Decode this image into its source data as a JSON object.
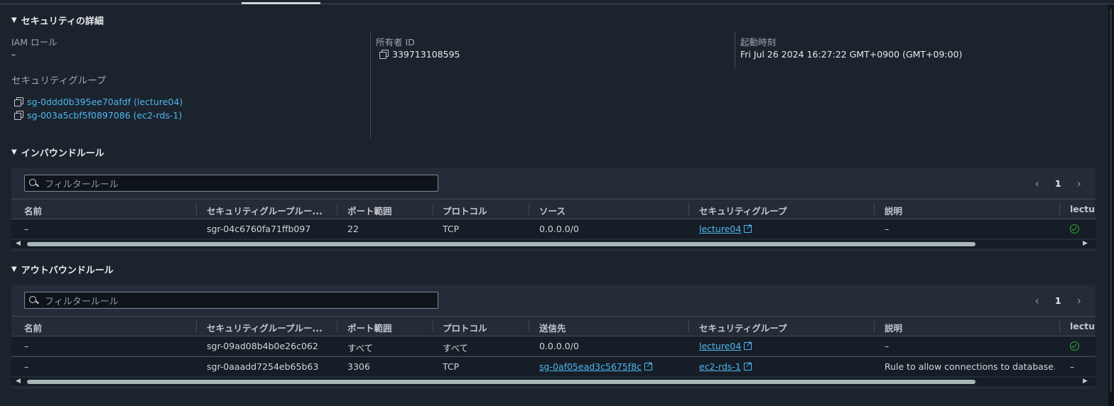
{
  "security_details": {
    "title": "セキュリティの詳細",
    "iam_role_label": "IAM ロール",
    "iam_role_value": "–",
    "security_groups_label": "セキュリティグループ",
    "security_groups": [
      "sg-0ddd0b395ee70afdf (lecture04)",
      "sg-003a5cbf5f0897086 (ec2-rds-1)"
    ],
    "owner_id_label": "所有者 ID",
    "owner_id_value": "339713108595",
    "launch_time_label": "起動時刻",
    "launch_time_value": "Fri Jul 26 2024 16:27:22 GMT+0900 (GMT+09:00)"
  },
  "inbound": {
    "title": "インバウンドルール",
    "filter_placeholder": "フィルタールール",
    "page": "1",
    "columns": [
      "名前",
      "セキュリティグループルー...",
      "ポート範囲",
      "プロトコル",
      "ソース",
      "セキュリティグループ",
      "説明",
      "lecture"
    ],
    "rows": [
      {
        "name": "–",
        "rule_id": "sgr-04c6760fa71ffb097",
        "port": "22",
        "protocol": "TCP",
        "source": "0.0.0.0/0",
        "security_group": "lecture04",
        "description": "–"
      }
    ]
  },
  "outbound": {
    "title": "アウトバウンドルール",
    "filter_placeholder": "フィルタールール",
    "page": "1",
    "columns": [
      "名前",
      "セキュリティグループルー...",
      "ポート範囲",
      "プロトコル",
      "送信先",
      "セキュリティグループ",
      "説明",
      "lectur"
    ],
    "rows": [
      {
        "name": "–",
        "rule_id": "sgr-09ad08b4b0e26c062",
        "port": "すべて",
        "protocol": "すべて",
        "destination": "0.0.0.0/0",
        "security_group": "lecture04",
        "description": "–",
        "extra": ""
      },
      {
        "name": "–",
        "rule_id": "sgr-0aaadd7254eb65b63",
        "port": "3306",
        "protocol": "TCP",
        "destination": "sg-0af05ead3c5675f8c",
        "security_group": "ec2-rds-1",
        "description": "Rule to allow connections to database…",
        "extra": "–"
      }
    ]
  },
  "colors": {
    "background": "#1b232d",
    "link": "#4eb7f0",
    "success": "#29ad32"
  }
}
